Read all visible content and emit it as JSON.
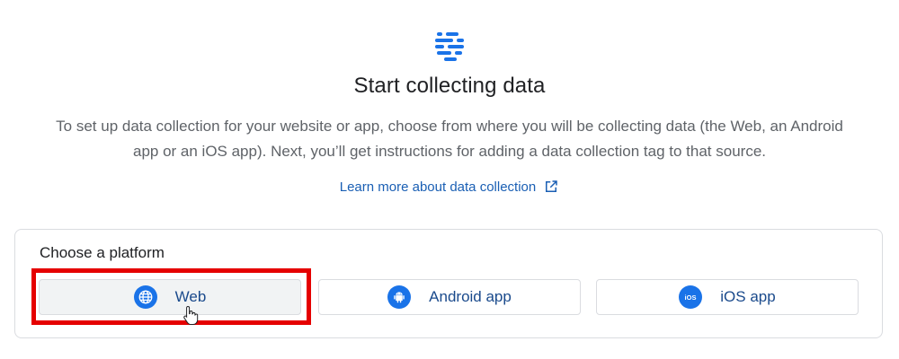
{
  "header": {
    "logo_icon": "data-stream-icon",
    "title": "Start collecting data",
    "description": "To set up data collection for your website or app, choose from where you will be collecting data (the Web, an Android app or an iOS app). Next, you’ll get instructions for adding a data collection tag to that source.",
    "learn_more_label": "Learn more about data collection",
    "learn_more_icon": "open-in-new-icon"
  },
  "platform_card": {
    "label": "Choose a platform",
    "options": [
      {
        "label": "Web",
        "icon": "globe-icon",
        "selected": true
      },
      {
        "label": "Android app",
        "icon": "android-icon",
        "selected": false
      },
      {
        "label": "iOS app",
        "icon": "ios-icon",
        "selected": false
      }
    ],
    "ios_icon_text": "iOS"
  },
  "colors": {
    "accent": "#1a73e8",
    "link": "#1a5fb4",
    "highlight": "#e50000",
    "border": "#dadce0"
  }
}
